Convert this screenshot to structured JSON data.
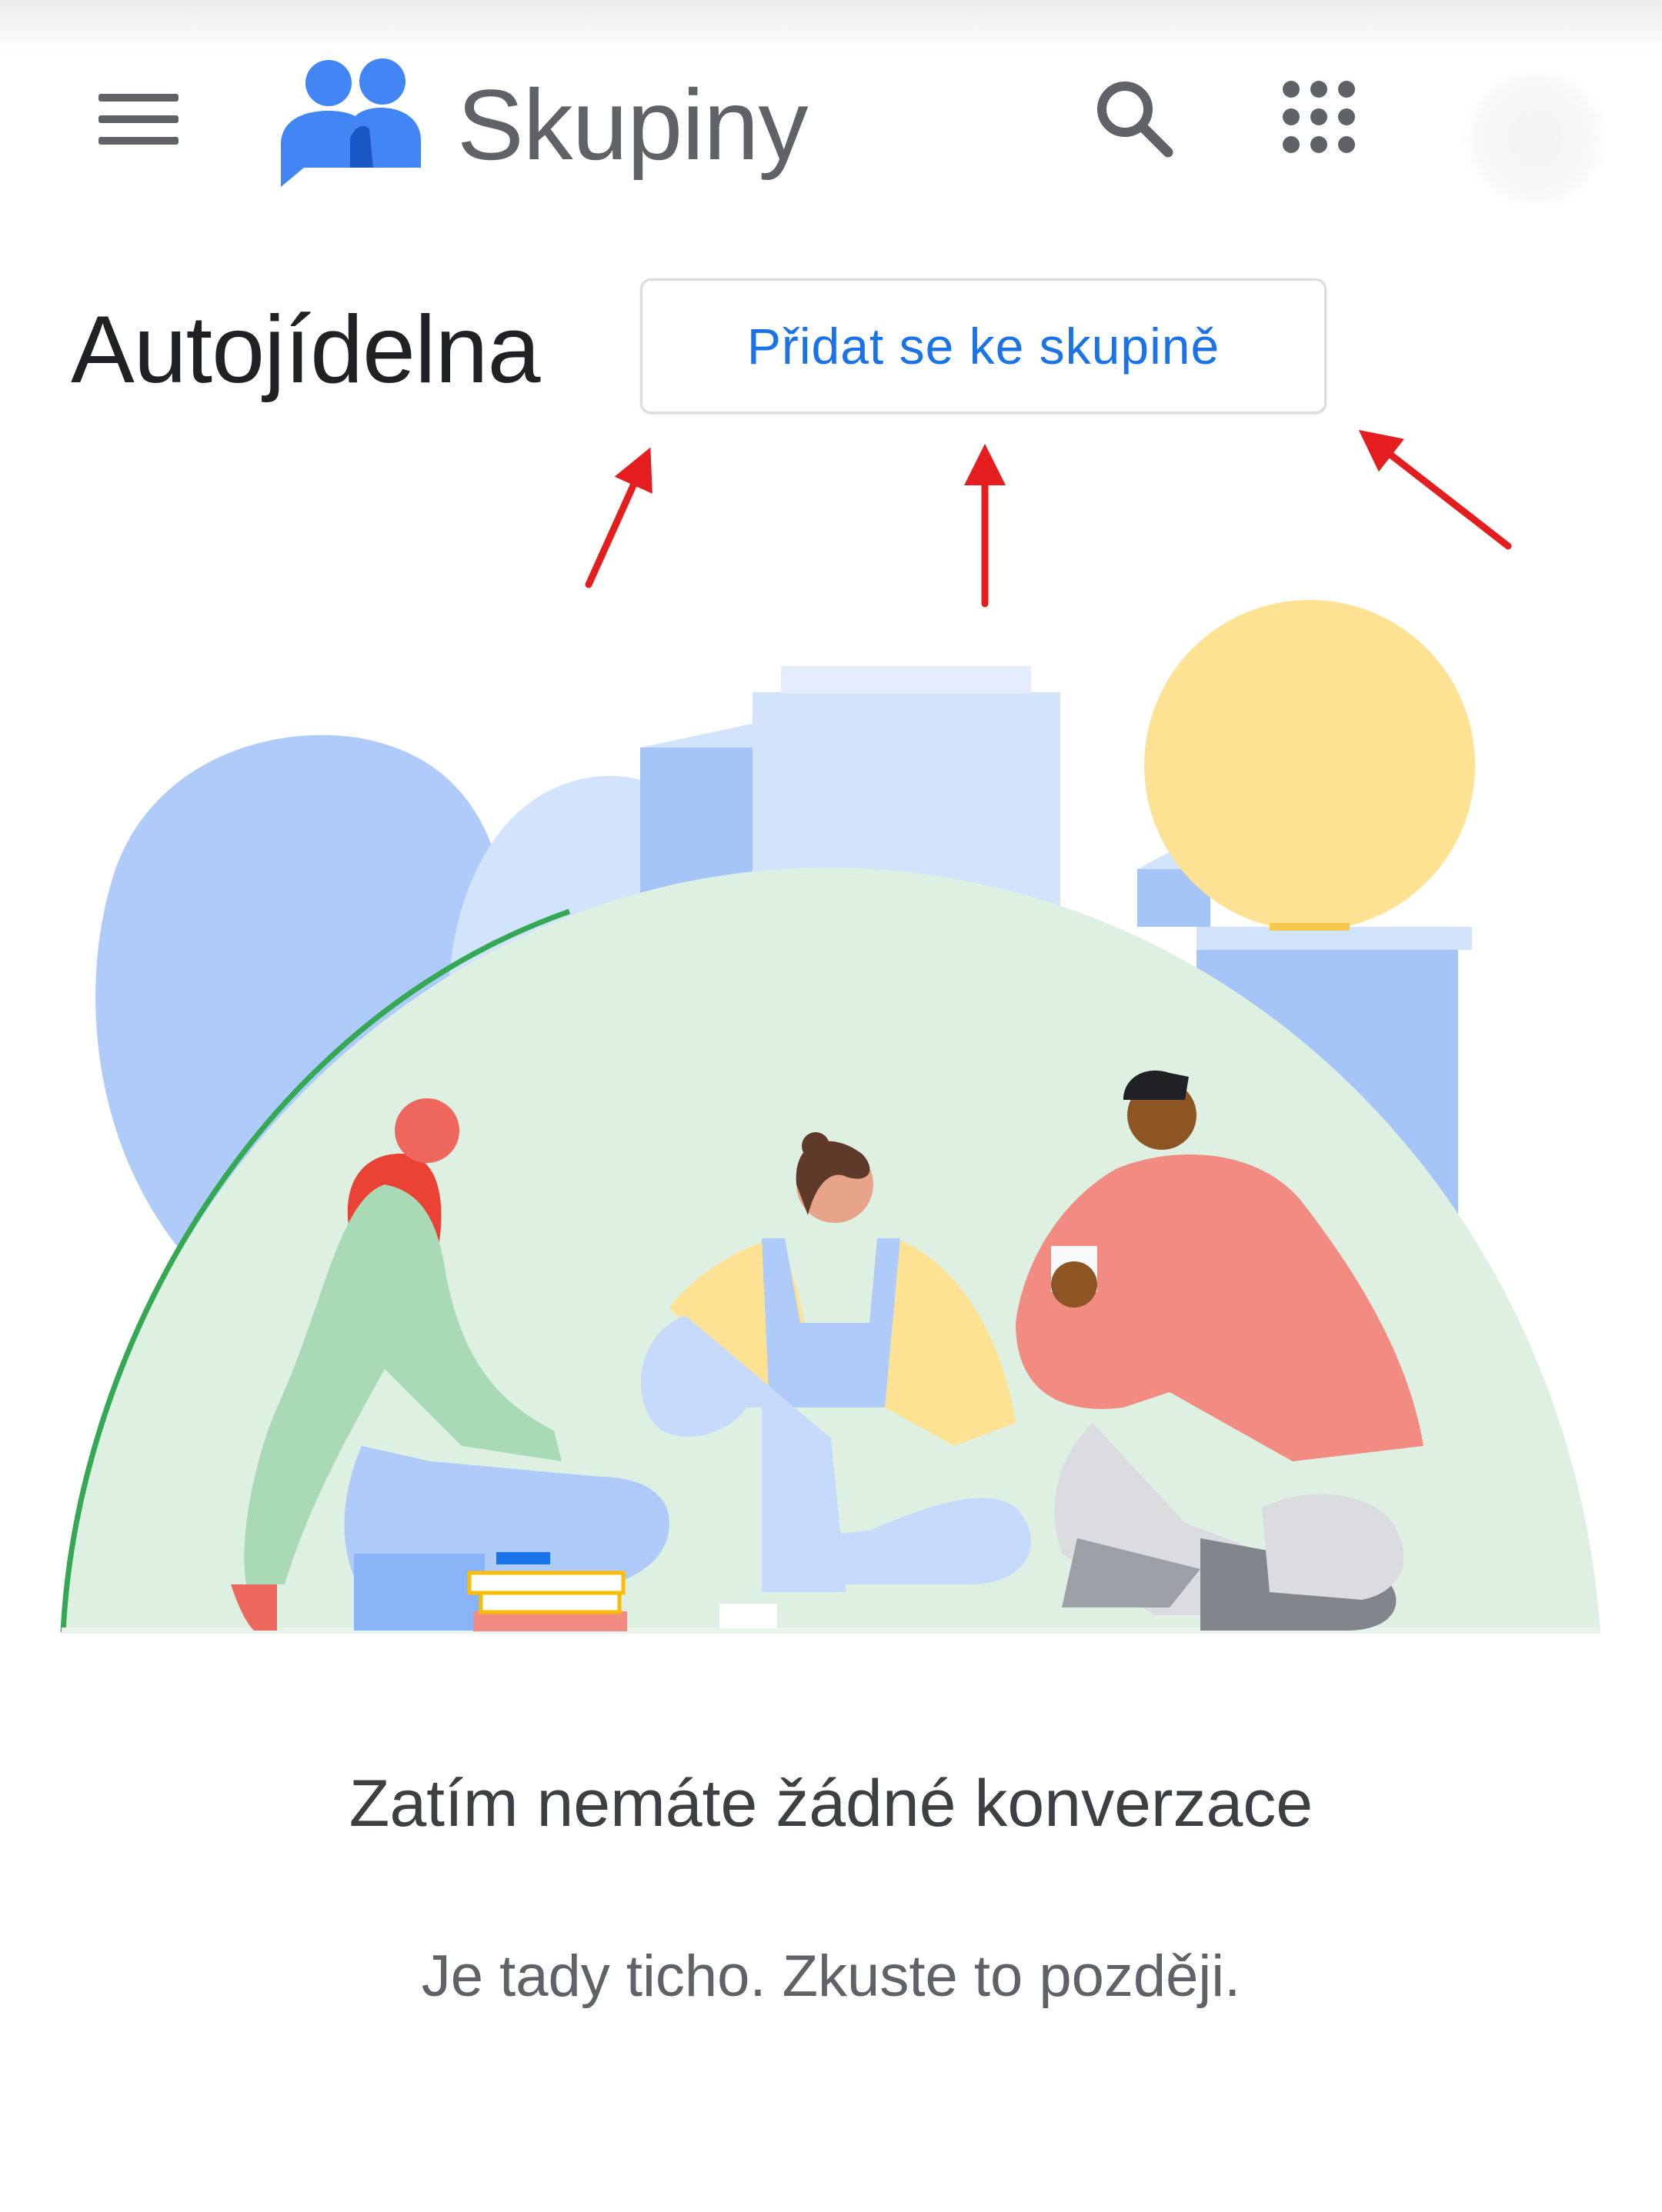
{
  "header": {
    "app_title": "Skupiny",
    "menu_icon": "hamburger-menu-icon",
    "logo_icon": "groups-logo-icon",
    "search_icon": "search-icon",
    "apps_icon": "apps-grid-icon",
    "account_icon": "account-avatar"
  },
  "group": {
    "name": "Autojídelna",
    "join_button_label": "Přidat se ke skupině"
  },
  "annotations": {
    "arrow_color": "#e41e1e",
    "arrow_count": 3
  },
  "empty_state": {
    "title": "Zatím nemáte žádné konverzace",
    "subtitle": "Je tady ticho. Zkuste to později."
  },
  "colors": {
    "brand_blue": "#4285f4",
    "link_blue": "#1a73e8",
    "text_primary": "#202124",
    "text_secondary": "#5f6368"
  }
}
